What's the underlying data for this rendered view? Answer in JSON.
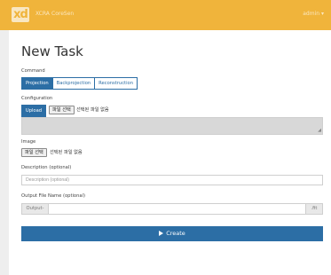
{
  "nav": {
    "logo": "xd",
    "links": [
      "XCRA",
      "CoreSen"
    ],
    "user": "admin"
  },
  "page": {
    "title": "New Task"
  },
  "command": {
    "label": "Command",
    "tabs": [
      "Projection",
      "Backprojection",
      "Reconstruction"
    ],
    "active": "Projection"
  },
  "configuration": {
    "label": "Configuration",
    "upload_label": "Upload",
    "file_button": "파일 선택",
    "file_status": "선택된 파일 없음"
  },
  "image": {
    "label": "Image",
    "file_button": "파일 선택",
    "file_status": "선택된 파일 없음"
  },
  "description": {
    "label": "Description (optional)",
    "placeholder": "Description (optional)",
    "value": ""
  },
  "output": {
    "label": "Output File Name (optional)",
    "prefix": "Output-",
    "suffix": ".fit",
    "value": ""
  },
  "create": {
    "label": "Create"
  }
}
